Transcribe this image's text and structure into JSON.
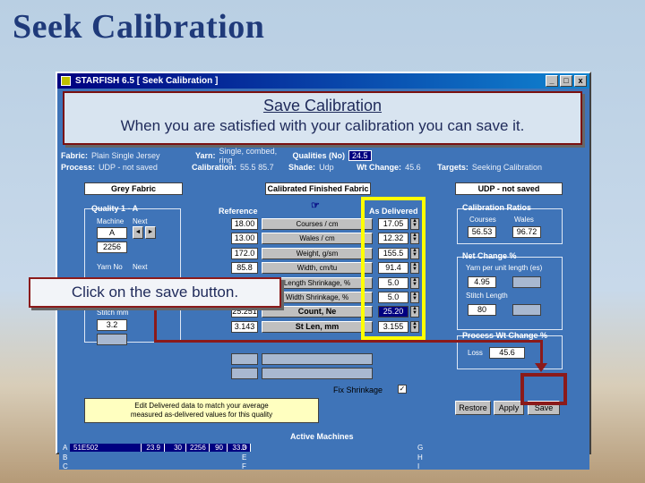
{
  "slide": {
    "title": "Seek Calibration"
  },
  "window": {
    "title": "STARFISH 6.5    [ Seek Calibration ]",
    "buttons": {
      "min": "_",
      "max": "□",
      "close": "x"
    }
  },
  "callouts": {
    "main_title": "Save Calibration",
    "main_text": "When you are satisfied with your calibration you can save it.",
    "save_hint": "Click on the save button."
  },
  "info": {
    "fabric_label": "Fabric:",
    "fabric_value": "Plain Single Jersey",
    "yarn_label": "Yarn:",
    "yarn_value": "Single, combed, ring",
    "qualities_label": "Qualities (No)",
    "qualities_value": "24.5",
    "process_label": "Process:",
    "process_value": "UDP - not saved",
    "calibration_label": "Calibration:",
    "calibration_value": "55.5  85.7",
    "shade_label": "Shade:",
    "shade_value": "Udp",
    "wtchange_label": "Wt Change:",
    "wtchange_value": "45.6",
    "targets_label": "Targets:",
    "targets_value": "Seeking Calibration"
  },
  "headers": {
    "grey_fabric": "Grey Fabric",
    "calibrated_fabric": "Calibrated Finished Fabric",
    "udp": "UDP - not saved"
  },
  "quality": {
    "title": "Quality 1 - A",
    "machine_label": "Machine",
    "next_label": "Next",
    "machine_value": "A",
    "machine_num": "2256",
    "yarn_no_label": "Yarn No",
    "yarn_next_label": "Next",
    "stitch_label": "Stitch mm",
    "stitch_value": "3.2"
  },
  "table": {
    "reference_label": "Reference",
    "as_delivered_label": "As Delivered",
    "rows": [
      {
        "label": "Courses / cm",
        "ref": "18.00",
        "del": "17.05"
      },
      {
        "label": "Wales / cm",
        "ref": "13.00",
        "del": "12.32"
      },
      {
        "label": "Weight, g/sm",
        "ref": "172.0",
        "del": "155.5"
      },
      {
        "label": "Width, cm/tu",
        "ref": "85.8",
        "del": "91.4"
      },
      {
        "label": "Length Shrinkage, %",
        "ref": "",
        "del": "5.0"
      },
      {
        "label": "Width Shrinkage, %",
        "ref": "",
        "del": "5.0"
      },
      {
        "label": "Count, Ne",
        "ref": "25.251",
        "del": "25.20"
      },
      {
        "label": "St Len, mm",
        "ref": "3.143",
        "del": "3.155"
      }
    ],
    "fix_shrinkage_label": "Fix Shrinkage",
    "fix_shrinkage_check": "✓"
  },
  "ratios": {
    "title": "Calibration Ratios",
    "courses_label": "Courses",
    "wales_label": "Wales",
    "courses_value": "56.53",
    "wales_value": "96.72"
  },
  "netchange": {
    "title": "Net Change %",
    "yarn_label": "Yarn per unit length (es)",
    "yarn_value": "4.95",
    "stitch_label": "Stitch Length",
    "stitch_value": "80"
  },
  "process": {
    "title": "Process Wt Change %",
    "loss_label": "Loss",
    "loss_value": "45.6"
  },
  "hint": {
    "line1": "Edit Delivered data to match your average",
    "line2": "measured as-delivered values for this quality"
  },
  "buttons": {
    "restore": "Restore",
    "apply": "Apply",
    "save": "Save"
  },
  "machines": {
    "title": "Active Machines",
    "row_a": {
      "letter": "A",
      "code": "51E502",
      "v1": "23.9",
      "v2": "30",
      "v3": "2256",
      "v4": "90",
      "v5": "33.3"
    },
    "letters_left": [
      "B",
      "C"
    ],
    "letters_mid": [
      "D",
      "E",
      "F"
    ],
    "letters_right": [
      "G",
      "H",
      "I"
    ]
  }
}
